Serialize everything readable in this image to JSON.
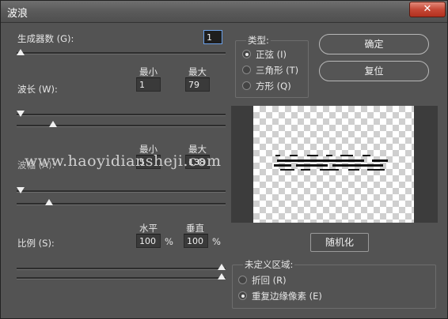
{
  "window": {
    "title": "波浪",
    "close_glyph": "✕"
  },
  "generators": {
    "label": "生成器数 (G):",
    "value": "1",
    "slider_value_fraction": 0.0
  },
  "wavelength": {
    "label": "波长 (W):",
    "min_header": "最小",
    "max_header": "最大",
    "min": "1",
    "max": "79",
    "min_slider_fraction": 0.0,
    "max_slider_fraction": 0.08
  },
  "amplitude": {
    "label": "波幅 (A):",
    "min_header": "最小",
    "max_header": "最大",
    "min": "5",
    "max": "138",
    "min_slider_fraction": 0.0,
    "max_slider_fraction": 0.14
  },
  "scale": {
    "label": "比例 (S):",
    "horizontal_header": "水平",
    "vertical_header": "垂直",
    "horizontal": "100",
    "vertical": "100",
    "percent": "%",
    "horizontal_slider_fraction": 1.0,
    "vertical_slider_fraction": 1.0
  },
  "type_group": {
    "title": "类型:",
    "options": [
      {
        "label": "正弦 (I)",
        "selected": true
      },
      {
        "label": "三角形 (T)",
        "selected": false
      },
      {
        "label": "方形 (Q)",
        "selected": false
      }
    ]
  },
  "buttons": {
    "ok": "确定",
    "reset": "复位",
    "randomize": "随机化"
  },
  "undefined_area": {
    "title": "未定义区域:",
    "options": [
      {
        "label": "折回 (R)",
        "selected": false
      },
      {
        "label": "重复边缘像素 (E)",
        "selected": true
      }
    ]
  },
  "watermark": "www.haoyidiansheji.com",
  "colors": {
    "dialog_bg": "#535353",
    "close_red": "#c64836",
    "focus_blue": "#6aa0e8"
  }
}
